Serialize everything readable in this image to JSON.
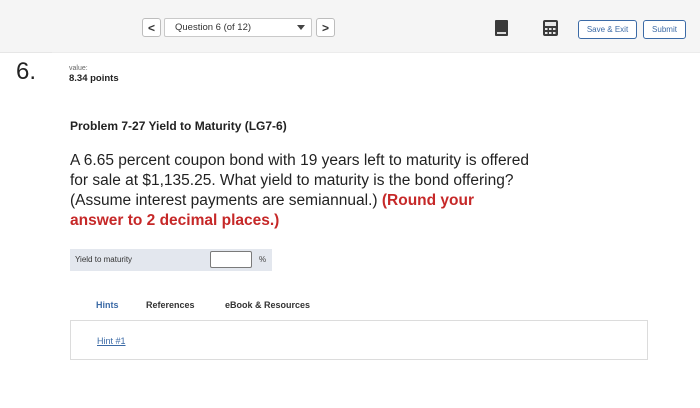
{
  "header": {
    "prev_glyph": "<",
    "question_selector": "Question 6 (of 12)",
    "next_glyph": ">",
    "save_exit_label": "Save & Exit",
    "submit_label": "Submit"
  },
  "question": {
    "number": "6.",
    "value_label": "value:",
    "points": "8.34 points",
    "title": "Problem 7-27 Yield to Maturity (LG7-6)",
    "body": "A 6.65 percent coupon bond with 19 years left to maturity is offered for sale at $1,135.25. What yield to maturity is the bond offering? (Assume interest payments are semiannual.)",
    "instruction": "(Round your answer to 2 decimal places.)"
  },
  "answer": {
    "label": "Yield to maturity",
    "value": "",
    "unit": "%"
  },
  "tabs": {
    "items": [
      "Hints",
      "References",
      "eBook & Resources"
    ],
    "active": "Hints"
  },
  "hints": {
    "link": "Hint #1"
  },
  "colors": {
    "accent": "#3b6aa6",
    "emphasis": "#c62828"
  }
}
